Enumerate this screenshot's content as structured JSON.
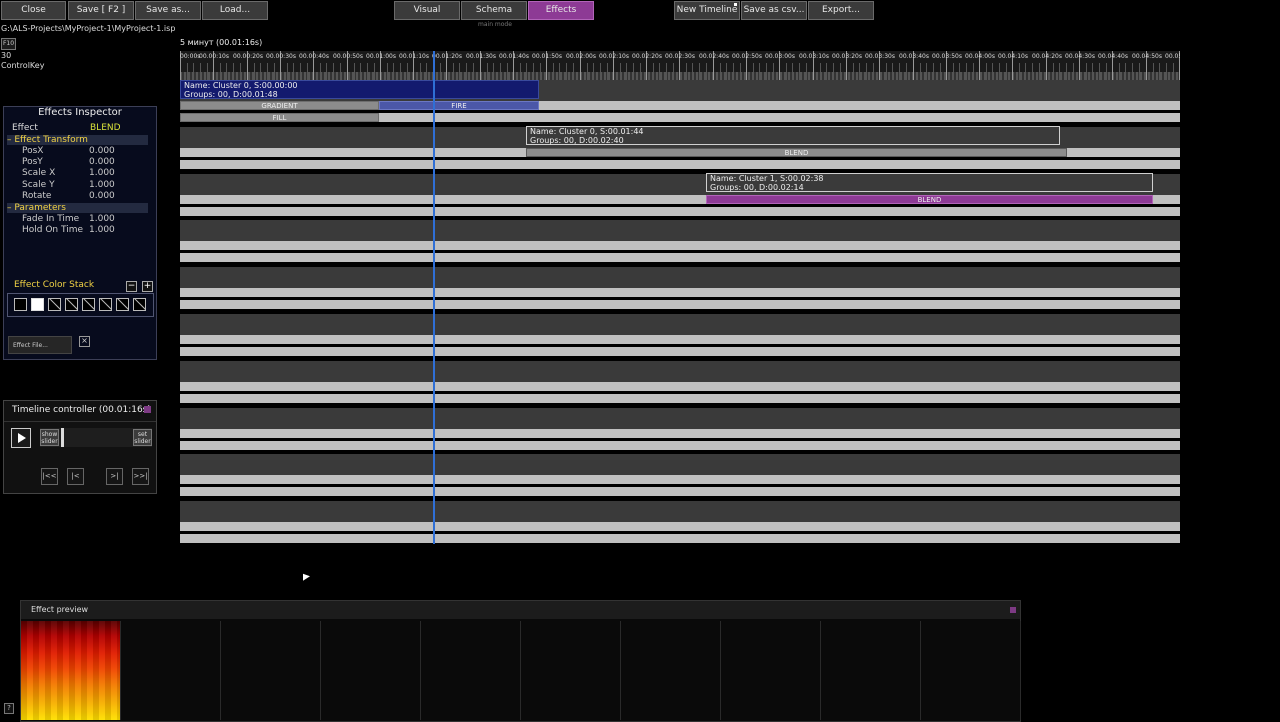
{
  "toolbar": {
    "close": "Close",
    "save": "Save [ F2 ]",
    "save_as": "Save as...",
    "load": "Load...",
    "modes": [
      "Visual",
      "Schema",
      "Effects"
    ],
    "active_mode": "Effects",
    "mode_caption": "main mode",
    "new_timeline": "New Timeline",
    "save_csv": "Save as csv...",
    "export": "Export..."
  },
  "project": {
    "path": "G:\\ALS-Projects\\MyProject-1\\MyProject-1.isp",
    "fkey": "F10",
    "fps": "30",
    "control": "ControlKey"
  },
  "inspector": {
    "title": "Effects Inspector",
    "effect_label": "Effect",
    "effect_value": "BLEND",
    "transform_section": "Effect Transform",
    "transform": [
      {
        "label": "PosX",
        "value": "0.000"
      },
      {
        "label": "PosY",
        "value": "0.000"
      },
      {
        "label": "Scale X",
        "value": "1.000"
      },
      {
        "label": "Scale Y",
        "value": "1.000"
      },
      {
        "label": "Rotate",
        "value": "0.000"
      }
    ],
    "params_section": "Parameters",
    "params": [
      {
        "label": "Fade In Time",
        "value": "1.000"
      },
      {
        "label": "Hold On Time",
        "value": "1.000"
      }
    ],
    "color_stack": "Effect Color Stack",
    "minus": "−",
    "plus": "+",
    "effect_file": "Effect File...",
    "clear": "×"
  },
  "controller": {
    "title": "Timeline controller (00.01:16s)",
    "show_slider": "show slider",
    "set_slider": "set slider",
    "to_start": "|<<",
    "prev": "|<",
    "next": ">|",
    "to_end": ">>|"
  },
  "timeline": {
    "duration": "5 минут (00.01:16s)",
    "ticks": [
      "00:00s",
      "00.00:10s",
      "00.00:20s",
      "00.00:30s",
      "00.00:40s",
      "00.00:50s",
      "00.01:00s",
      "00.01:10s",
      "00.01:20s",
      "00.01:30s",
      "00.01:40s",
      "00.01:50s",
      "00.02:00s",
      "00.02:10s",
      "00.02:20s",
      "00.02:30s",
      "00.02:40s",
      "00.02:50s",
      "00.03:00s",
      "00.03:10s",
      "00.03:20s",
      "00.03:30s",
      "00.03:40s",
      "00.03:50s",
      "00.04:00s",
      "00.04:10s",
      "00.04:20s",
      "00.04:30s",
      "00.04:40s",
      "00.04:50s",
      "00.05:00s"
    ],
    "clips": [
      {
        "name": "Name: Cluster 0, S:00.00:00",
        "info": "Groups: 00, D:00.01:48",
        "effects": [
          "GRADIENT",
          "FIRE",
          "FILL"
        ]
      },
      {
        "name": "Name: Cluster 0, S:00.01:44",
        "info": "Groups: 00, D:00.02:40",
        "effects": [
          "BLEND"
        ]
      },
      {
        "name": "Name: Cluster 1, S:00.02:38",
        "info": "Groups: 00, D:00.02:14",
        "effects": [
          "BLEND"
        ]
      }
    ],
    "colors": {
      "playhead": "#2f6fd6",
      "selected_clip": "#131a6e",
      "fire": "#4b57a8",
      "blend_active": "#8d3a95"
    }
  },
  "preview": {
    "title": "Effect preview",
    "help": "?"
  }
}
